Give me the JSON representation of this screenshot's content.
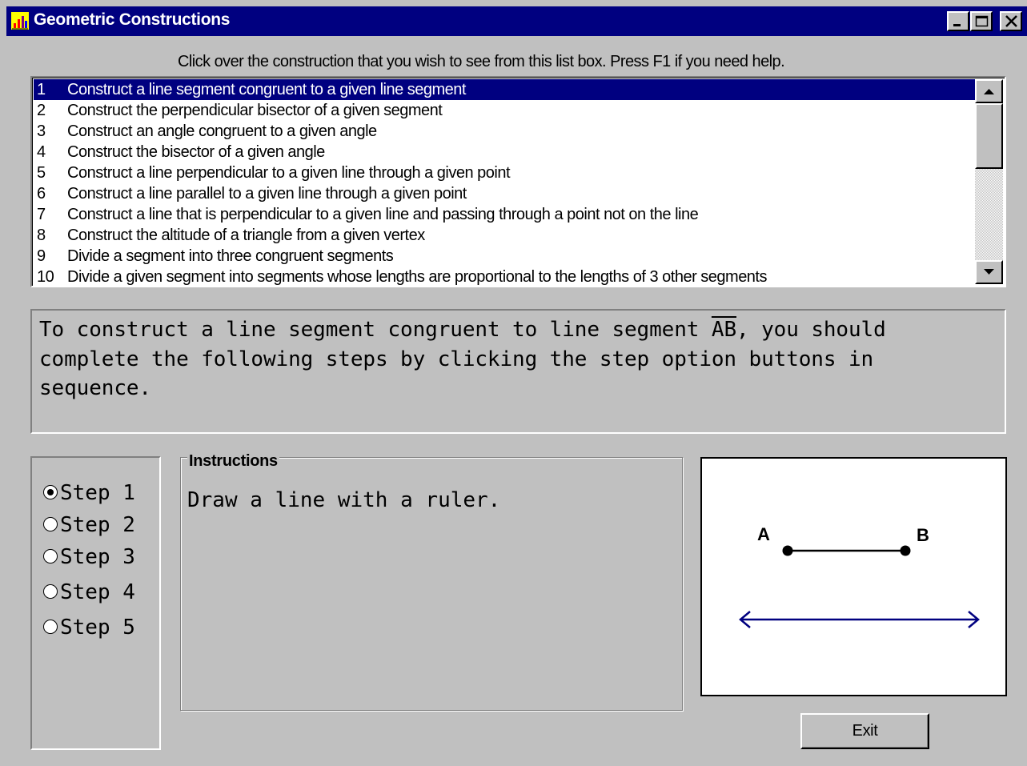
{
  "window": {
    "title": "Geometric Constructions",
    "icon": "chart-app-icon"
  },
  "prompt": "Click over the construction that you wish to see from this list box.  Press F1 if you need help.",
  "constructions": [
    {
      "num": "1",
      "text": "Construct a line segment congruent to a given line segment",
      "selected": true
    },
    {
      "num": "2",
      "text": "Construct the perpendicular bisector of a given segment"
    },
    {
      "num": "3",
      "text": "Construct an angle congruent to a given angle"
    },
    {
      "num": "4",
      "text": "Construct the bisector of a given angle"
    },
    {
      "num": "5",
      "text": "Construct a line perpendicular to a given line through a given point"
    },
    {
      "num": "6",
      "text": "Construct a line parallel to a given line through a given point"
    },
    {
      "num": "7",
      "text": "Construct a line that is perpendicular to a given line and passing through a point not on the line"
    },
    {
      "num": "8",
      "text": "Construct the altitude of a triangle from a given vertex"
    },
    {
      "num": "9",
      "text": "Divide a segment into three congruent segments"
    },
    {
      "num": "10",
      "text": "Divide a given segment into segments whose lengths are proportional to the lengths of 3 other segments"
    }
  ],
  "description": {
    "before": "To construct a line segment congruent to line segment ",
    "segment": "AB",
    "after": ", you should complete the following steps by clicking the step option buttons in sequence."
  },
  "steps": [
    {
      "label": "Step 1",
      "checked": true
    },
    {
      "label": "Step 2",
      "checked": false
    },
    {
      "label": "Step 3",
      "checked": false
    },
    {
      "label": "Step 4",
      "checked": false
    },
    {
      "label": "Step 5",
      "checked": false
    }
  ],
  "instructions": {
    "legend": "Instructions",
    "text": "Draw a line with a ruler."
  },
  "diagram": {
    "point_a": "A",
    "point_b": "B",
    "line_color": "#000080"
  },
  "exit_label": "Exit"
}
